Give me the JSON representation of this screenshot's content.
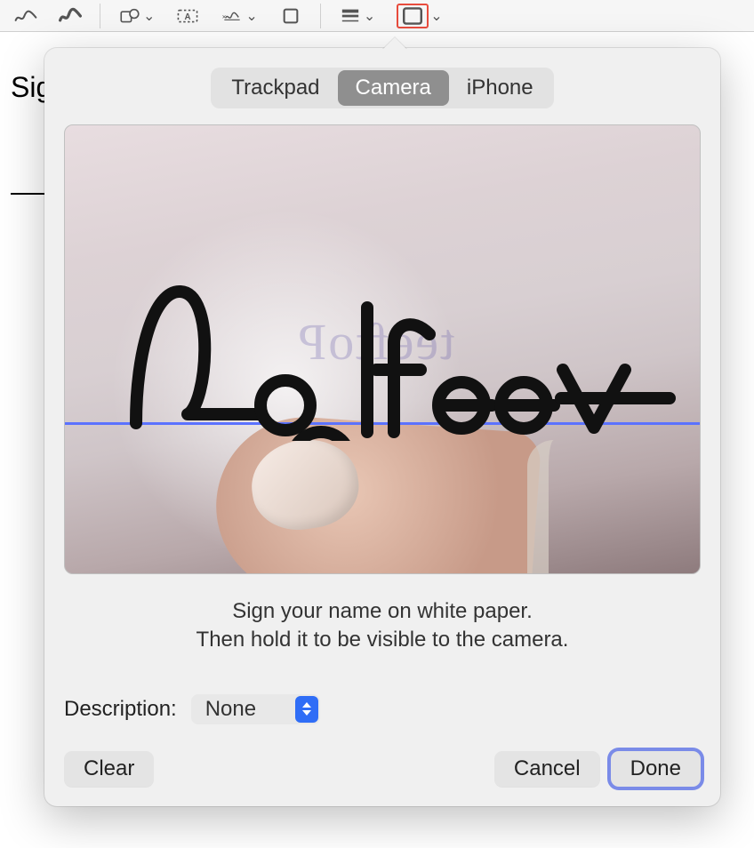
{
  "toolbar": {
    "icons": [
      "squiggle-draw",
      "brush-draw",
      "shapes",
      "text-box",
      "sign",
      "crop",
      "line-style",
      "border-style"
    ]
  },
  "background": {
    "partial_label": "Sig"
  },
  "popover": {
    "tabs": [
      "Trackpad",
      "Camera",
      "iPhone"
    ],
    "active_tab_index": 1,
    "signature_text": "Podfeet",
    "ghost_text": "teeftoP",
    "instructions": "Sign your name on white paper.\nThen hold it to be visible to the camera.",
    "description_label": "Description:",
    "description_value": "None",
    "buttons": {
      "clear": "Clear",
      "cancel": "Cancel",
      "done": "Done"
    }
  }
}
